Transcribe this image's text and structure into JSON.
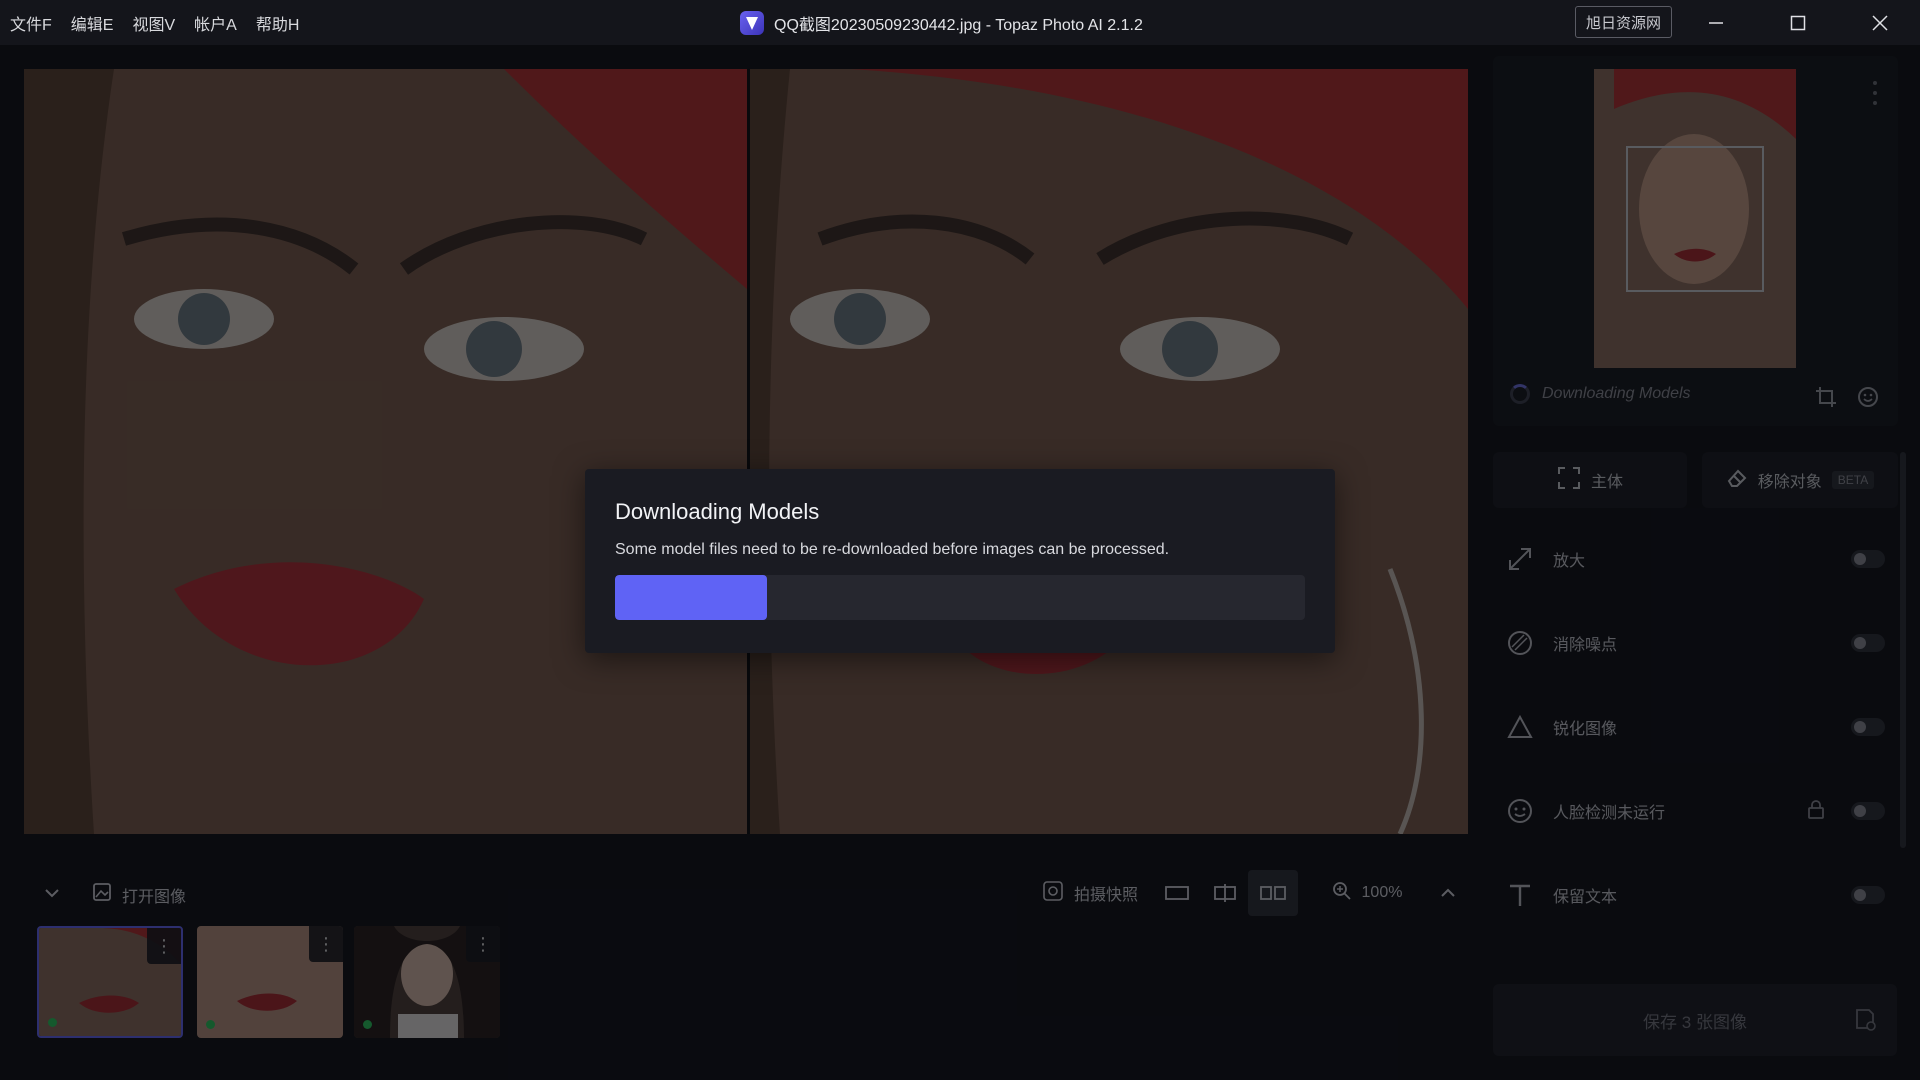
{
  "menu": [
    "文件F",
    "编辑E",
    "视图V",
    "帐户A",
    "帮助H"
  ],
  "window": {
    "title": "QQ截图20230509230442.jpg - Topaz Photo AI 2.1.2",
    "badge": "旭日资源网",
    "minimize_icon": "minimize-icon",
    "maximize_icon": "maximize-icon",
    "close_icon": "close-icon"
  },
  "panel": {
    "status": "Downloading Models",
    "tabs": [
      {
        "label": "主体",
        "icon": "focus-frame-icon"
      },
      {
        "label": "移除对象",
        "icon": "eraser-icon",
        "badge": "BETA"
      }
    ],
    "features": [
      {
        "label": "放大",
        "icon": "upscale-icon"
      },
      {
        "label": "消除噪点",
        "icon": "denoise-icon"
      },
      {
        "label": "锐化图像",
        "icon": "sharpen-icon"
      },
      {
        "label": "人脸检测未运行",
        "icon": "face-icon",
        "locked": true
      },
      {
        "label": "保留文本",
        "icon": "text-icon"
      }
    ],
    "save_label": "保存 3 张图像"
  },
  "bottombar": {
    "open_label": "打开图像",
    "snapshot_label": "拍摄快照",
    "zoom": "100%"
  },
  "modal": {
    "title": "Downloading Models",
    "message": "Some model files need to be re-downloaded before images can be processed.",
    "progress": 0.22
  },
  "colors": {
    "accent": "#5f63f5",
    "status_green": "#26c65a"
  }
}
